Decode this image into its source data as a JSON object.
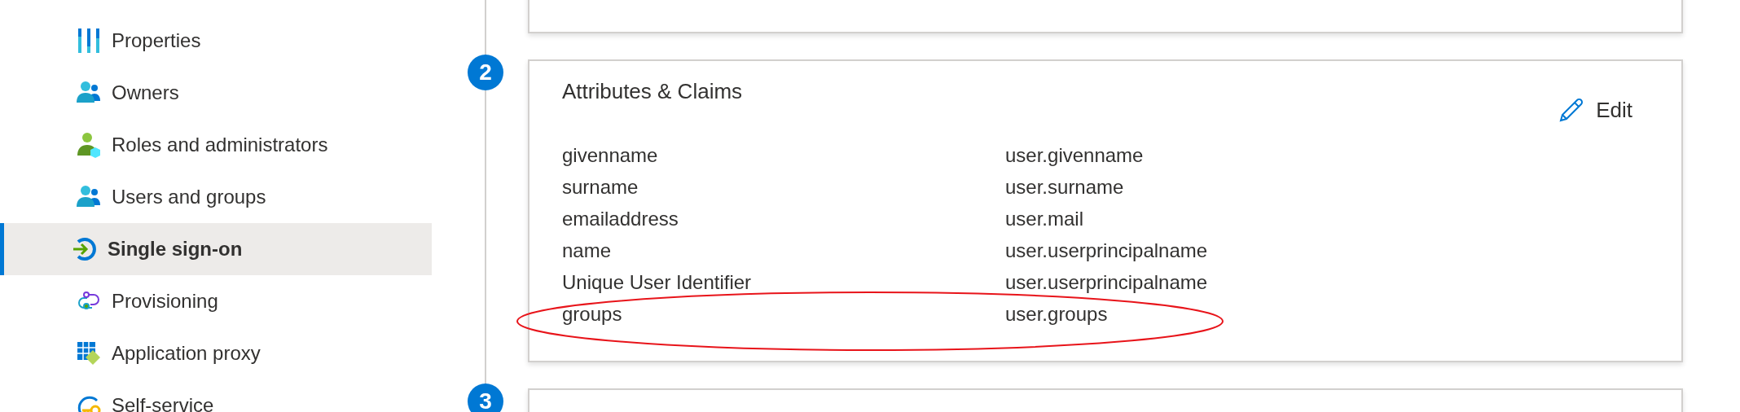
{
  "sidebar": {
    "items": [
      {
        "label": "Properties",
        "kind": "bars",
        "selected": false
      },
      {
        "label": "Owners",
        "kind": "people",
        "selected": false
      },
      {
        "label": "Roles and administrators",
        "kind": "admin",
        "selected": false
      },
      {
        "label": "Users and groups",
        "kind": "people",
        "selected": false
      },
      {
        "label": "Single sign-on",
        "kind": "signin",
        "selected": true
      },
      {
        "label": "Provisioning",
        "kind": "sync",
        "selected": false
      },
      {
        "label": "Application proxy",
        "kind": "grid",
        "selected": false
      },
      {
        "label": "Self-service",
        "kind": "key",
        "selected": false
      }
    ]
  },
  "sections": [
    {
      "kind": "empty"
    },
    {
      "kind": "claims",
      "number": "2",
      "title": "Attributes & Claims",
      "edit": "Edit",
      "rows": [
        {
          "claim": "givenname",
          "value": "user.givenname",
          "highlighted": false
        },
        {
          "claim": "surname",
          "value": "user.surname",
          "highlighted": false
        },
        {
          "claim": "emailaddress",
          "value": "user.mail",
          "highlighted": false
        },
        {
          "claim": "name",
          "value": "user.userprincipalname",
          "highlighted": false
        },
        {
          "claim": "Unique User Identifier",
          "value": "user.userprincipalname",
          "highlighted": false
        },
        {
          "claim": "groups",
          "value": "user.groups",
          "highlighted": true
        }
      ]
    },
    {
      "kind": "empty",
      "number": "3"
    }
  ]
}
